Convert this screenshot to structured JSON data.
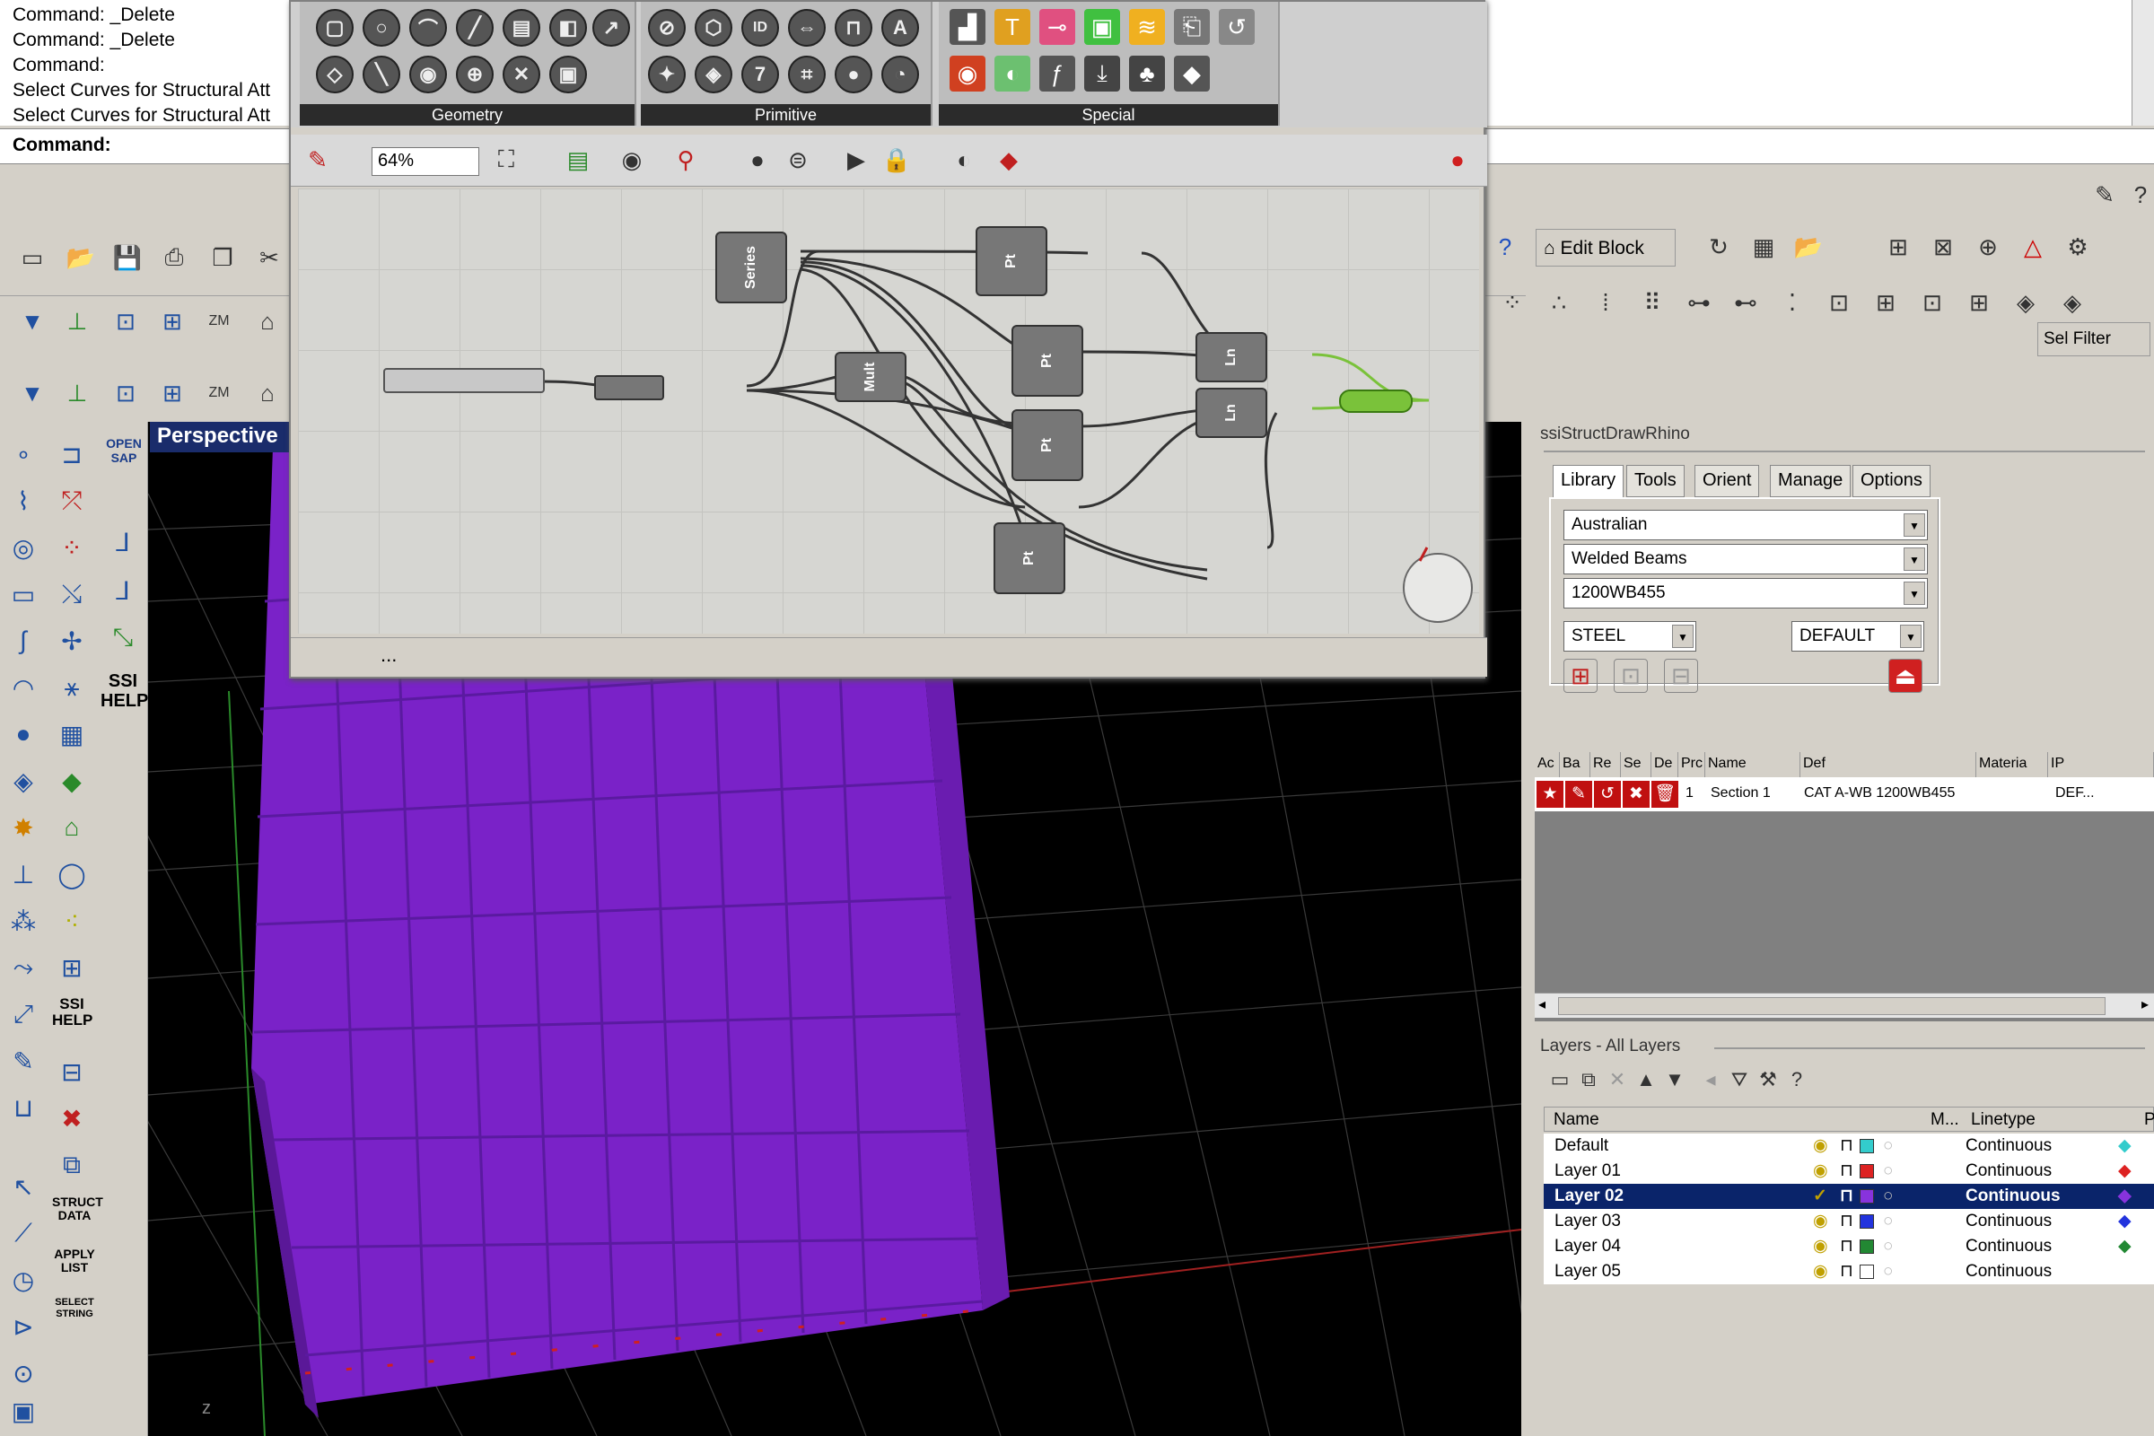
{
  "command": {
    "history": [
      "Command: _Delete",
      "Command: _Delete",
      "Command:",
      "Select Curves for Structural Att",
      "Select Curves for Structural Att"
    ],
    "prompt": "Command:"
  },
  "grasshopper": {
    "ribbon_groups": [
      "Geometry",
      "Primitive",
      "Special"
    ],
    "zoom": "64%",
    "status": "...",
    "components": [
      "Series",
      "Pt",
      "Mult",
      "Pt",
      "Pt",
      "Pt",
      "Ln",
      "Ln"
    ]
  },
  "toolbar": {
    "edit_block_label": "Edit Block",
    "sel_filter_label": "Sel Filter"
  },
  "viewport": {
    "title": "Perspective",
    "accent": "#7a22c8"
  },
  "left_tools": {
    "open_sap": "OPEN SAP",
    "ssi_help_1": "SSI HELP",
    "ssi_help_2": "SSI HELP",
    "struct_data": "STRUCT DATA",
    "apply_list": "APPLY LIST",
    "select_string": "SELECT STRING"
  },
  "ssi_panel": {
    "title": "ssiStructDrawRhino",
    "tabs": [
      "Library",
      "Tools",
      "Orient",
      "Manage",
      "Options"
    ],
    "standard": "Australian",
    "family": "Welded Beams",
    "section": "1200WB455",
    "material": "STEEL",
    "default": "DEFAULT",
    "table_headers": [
      "Ac",
      "Ba",
      "Re",
      "Se",
      "De",
      "Prc",
      "Name",
      "Def",
      "Materia",
      "IP"
    ],
    "row": {
      "prc": "1",
      "name": "Section 1",
      "def": "CAT A-WB 1200WB455",
      "ip": "DEF..."
    }
  },
  "layers_panel": {
    "title": "Layers - All Layers",
    "headers": [
      "Name",
      "M...",
      "Linetype",
      "P"
    ],
    "layers": [
      {
        "name": "Default",
        "linetype": "Continuous",
        "color": "#33cccc"
      },
      {
        "name": "Layer 01",
        "linetype": "Continuous",
        "color": "#dd2222"
      },
      {
        "name": "Layer 02",
        "linetype": "Continuous",
        "color": "#8833dd"
      },
      {
        "name": "Layer 03",
        "linetype": "Continuous",
        "color": "#2233dd"
      },
      {
        "name": "Layer 04",
        "linetype": "Continuous",
        "color": "#228833"
      },
      {
        "name": "Layer 05",
        "linetype": "Continuous",
        "color": "#ffffff"
      }
    ]
  }
}
